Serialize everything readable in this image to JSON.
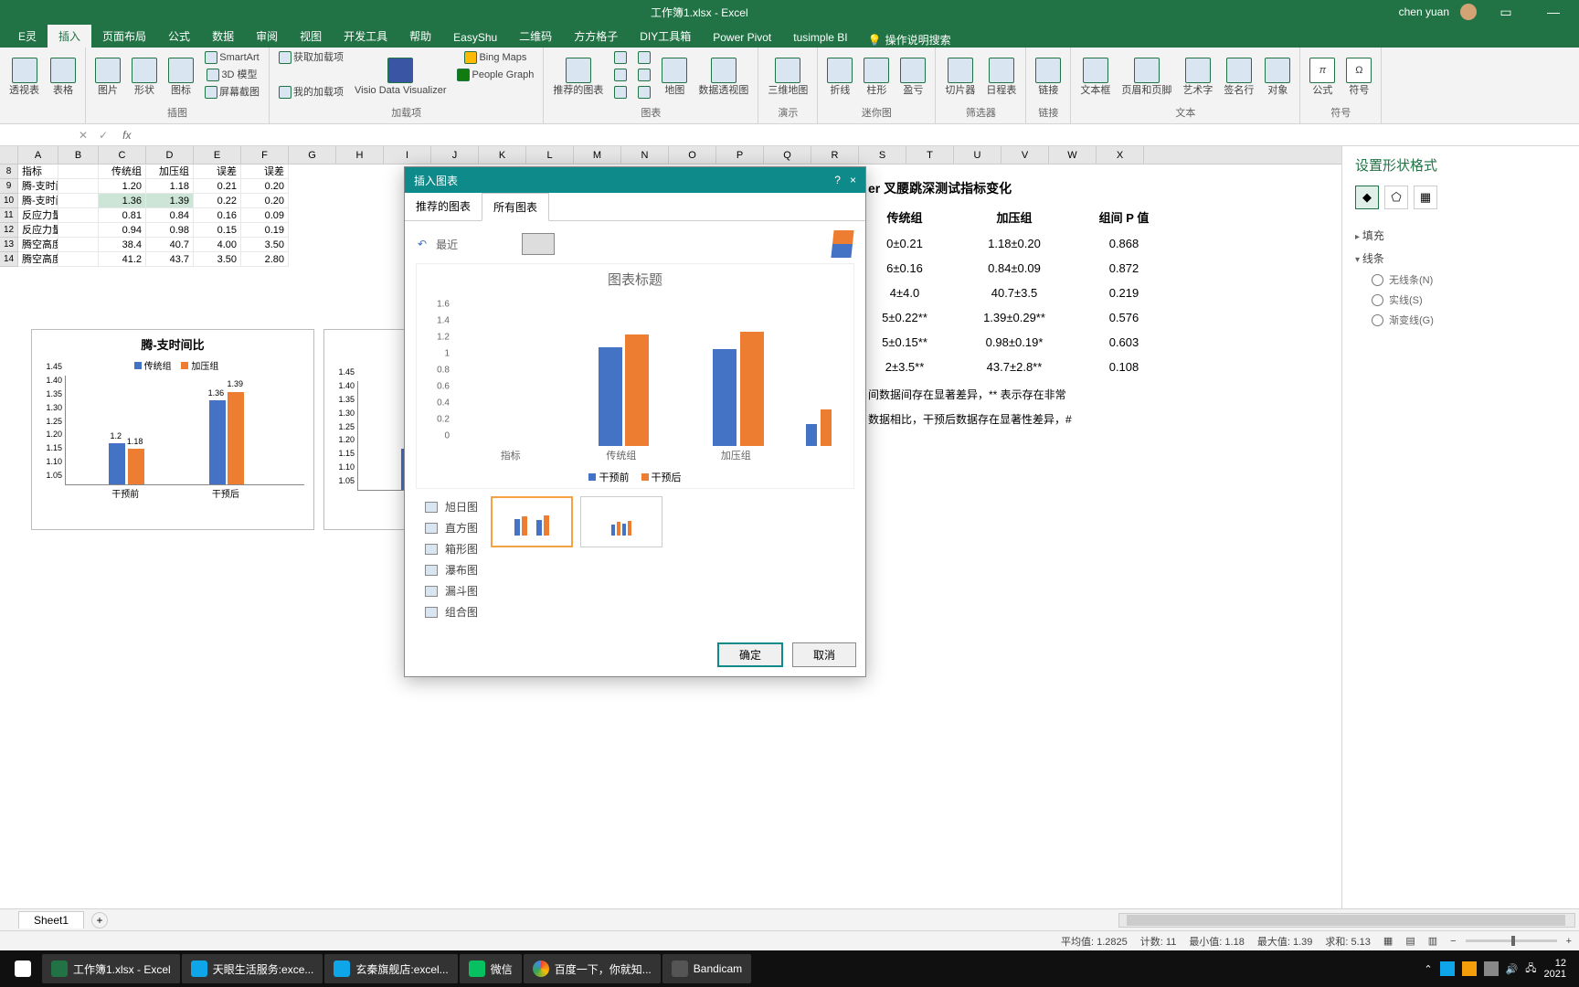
{
  "titlebar": {
    "title": "工作簿1.xlsx - Excel",
    "user": "chen yuan"
  },
  "ribbon_tabs": [
    "E灵",
    "插入",
    "页面布局",
    "公式",
    "数据",
    "审阅",
    "视图",
    "开发工具",
    "帮助",
    "EasyShu",
    "二维码",
    "方方格子",
    "DIY工具箱",
    "Power Pivot",
    "tusimple BI"
  ],
  "active_tab": "插入",
  "tell_me": "操作说明搜索",
  "ribbon_groups": {
    "illustrations": {
      "label": "插图",
      "pic": "图片",
      "shapes": "形状",
      "icons": "图标",
      "smartart": "SmartArt",
      "model3d": "3D 模型",
      "screenshot": "屏幕截图"
    },
    "tables": {
      "label": "",
      "table": "表格",
      "pivot": "透视表"
    },
    "addins": {
      "label": "加载项",
      "get": "获取加载项",
      "my": "我的加载项",
      "visio": "Visio Data Visualizer",
      "bing": "Bing Maps",
      "people": "People Graph"
    },
    "charts": {
      "label": "图表",
      "rec": "推荐的图表"
    },
    "maps": {
      "map": "地图",
      "pivotchart": "数据透视图"
    },
    "3d": {
      "label": "演示",
      "map3d": "三维地图"
    },
    "spark": {
      "label": "迷你图",
      "line": "折线",
      "col": "柱形",
      "winloss": "盈亏"
    },
    "filter": {
      "label": "筛选器",
      "slicer": "切片器",
      "timeline": "日程表"
    },
    "links": {
      "label": "链接",
      "link": "链接"
    },
    "text": {
      "label": "文本",
      "textbox": "文本框",
      "hf": "页眉和页脚",
      "wordart": "艺术字",
      "sig": "签名行",
      "obj": "对象"
    },
    "symbols": {
      "label": "符号",
      "eq": "公式",
      "sym": "符号"
    }
  },
  "colheads": [
    "A",
    "B",
    "C",
    "D",
    "E",
    "F",
    "G",
    "H",
    "I",
    "J",
    "K",
    "L",
    "M",
    "N",
    "O",
    "P",
    "Q",
    "R",
    "S",
    "T",
    "U",
    "V",
    "W",
    "X"
  ],
  "sheet": {
    "r8": {
      "A": "指标",
      "B": "",
      "C": "传统组",
      "D": "加压组",
      "E": "误差",
      "F": "误差"
    },
    "r9": {
      "A": "腾-支时间比",
      "C": "1.20",
      "D": "1.18",
      "E": "0.21",
      "F": "0.20"
    },
    "r10": {
      "A": "腾-支时间比",
      "C": "1.36",
      "D": "1.39",
      "E": "0.22",
      "F": "0.20"
    },
    "r11": {
      "A": "反应力量指数",
      "C": "0.81",
      "D": "0.84",
      "E": "0.16",
      "F": "0.09"
    },
    "r12": {
      "A": "反应力量指数",
      "C": "0.94",
      "D": "0.98",
      "E": "0.15",
      "F": "0.19"
    },
    "r13": {
      "A": "腾空高度（cm）",
      "C": "38.4",
      "D": "40.7",
      "E": "4.00",
      "F": "3.50"
    },
    "r14": {
      "A": "腾空高度（cm）",
      "C": "41.2",
      "D": "43.7",
      "E": "3.50",
      "F": "2.80"
    }
  },
  "selection": "C10:D10",
  "chart1": {
    "title": "腾-支时间比",
    "legend": [
      "传统组",
      "加压组"
    ],
    "yticks": [
      "1.05",
      "1.10",
      "1.15",
      "1.20",
      "1.25",
      "1.30",
      "1.35",
      "1.40",
      "1.45"
    ],
    "cats": [
      "干预前",
      "干预后"
    ],
    "vals": [
      [
        1.2,
        1.18
      ],
      [
        1.36,
        1.39
      ]
    ]
  },
  "dialog": {
    "title": "插入图表",
    "help": "?",
    "close": "×",
    "tabs": [
      "推荐的图表",
      "所有图表"
    ],
    "active_dtab": "所有图表",
    "toolbar_recent": "最近",
    "preview_title": "图表标题",
    "yticks": [
      "0",
      "0.2",
      "0.4",
      "0.6",
      "0.8",
      "1",
      "1.2",
      "1.4",
      "1.6"
    ],
    "cats": [
      "指标",
      "传统组",
      "加压组"
    ],
    "legend": [
      "干预前",
      "干预后"
    ],
    "types": [
      "旭日图",
      "直方图",
      "箱形图",
      "瀑布图",
      "漏斗图",
      "组合图"
    ],
    "ok": "确定",
    "cancel": "取消"
  },
  "chart_data": {
    "type": "bar",
    "title": "图表标题",
    "categories": [
      "指标",
      "传统组",
      "加压组"
    ],
    "series": [
      {
        "name": "干预前",
        "values": [
          null,
          1.2,
          1.18
        ]
      },
      {
        "name": "干预后",
        "values": [
          null,
          1.36,
          1.39
        ]
      }
    ],
    "ylim": [
      0,
      1.6
    ],
    "legend_pos": "bottom"
  },
  "datatable": {
    "title": "er 叉腰跳深测试指标变化",
    "heads": [
      "传统组",
      "加压组",
      "组间 P 值"
    ],
    "rows": [
      [
        "0±0.21",
        "1.18±0.20",
        "0.868"
      ],
      [
        "6±0.16",
        "0.84±0.09",
        "0.872"
      ],
      [
        "4±4.0",
        "40.7±3.5",
        "0.219"
      ],
      [
        "5±0.22**",
        "1.39±0.29**",
        "0.576"
      ],
      [
        "5±0.15**",
        "0.98±0.19*",
        "0.603"
      ],
      [
        "2±3.5**",
        "43.7±2.8**",
        "0.108"
      ]
    ],
    "note1": "间数据间存在显著差异，** 表示存在非常",
    "note2": "数据相比，干预后数据存在显著性差异，#"
  },
  "side": {
    "title": "设置形状格式",
    "fill": "填充",
    "line": "线条",
    "noline": "无线条(N)",
    "solid": "实线(S)",
    "gradient": "渐变线(G)"
  },
  "status": {
    "avg": "平均值: 1.2825",
    "count": "计数: 11",
    "min": "最小值: 1.18",
    "max": "最大值: 1.39",
    "sum": "求和: 5.13"
  },
  "sheet_tab": "Sheet1",
  "taskbar": {
    "excel": "工作簿1.xlsx - Excel",
    "app2": "天眼生活服务:exce...",
    "app3": "玄秦旗舰店:excel...",
    "wechat": "微信",
    "baidu": "百度一下，你就知...",
    "bandicam": "Bandicam",
    "time_top": "12",
    "time_bot": "2021"
  }
}
